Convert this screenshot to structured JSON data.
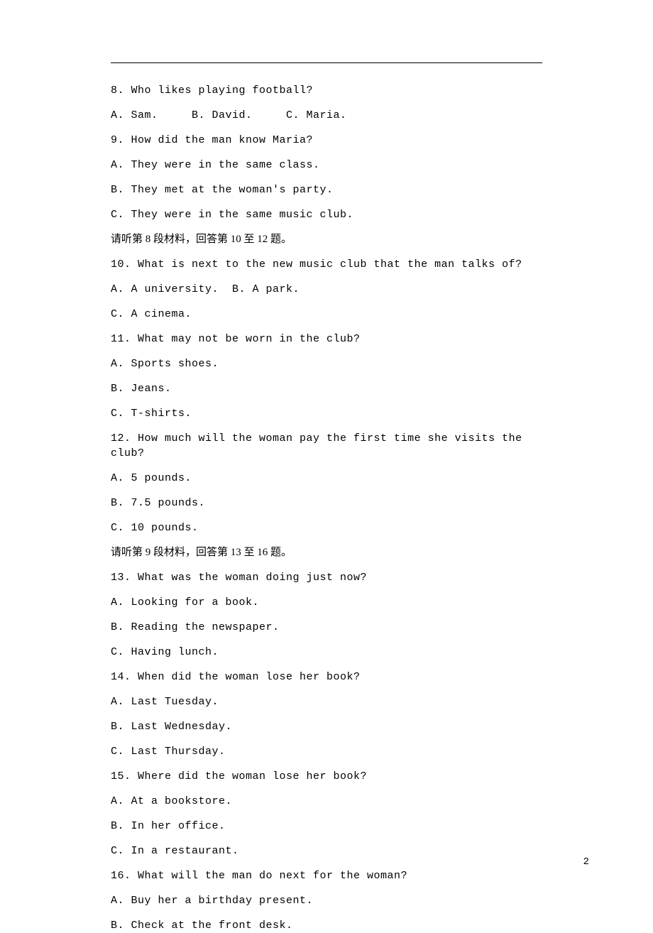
{
  "lines": [
    {
      "cls": "mono",
      "text": "8. Who likes playing football?"
    },
    {
      "cls": "mono",
      "text": "A. Sam.     B. David.     C. Maria."
    },
    {
      "cls": "mono",
      "text": "9. How did the man know Maria?"
    },
    {
      "cls": "mono",
      "text": "A. They were in the same class."
    },
    {
      "cls": "mono",
      "text": "B. They met at the woman's party."
    },
    {
      "cls": "mono",
      "text": "C. They were in the same music club."
    },
    {
      "cls": "",
      "text": "请听第 8 段材料，回答第 10 至 12 题。"
    },
    {
      "cls": "mono",
      "text": "10. What is next to the new music club that the man talks of?"
    },
    {
      "cls": "mono",
      "text": "A. A university.  B. A park."
    },
    {
      "cls": "mono",
      "text": "C. A cinema."
    },
    {
      "cls": "mono",
      "text": "11. What may not be worn in the club?"
    },
    {
      "cls": "mono",
      "text": "A. Sports shoes."
    },
    {
      "cls": "mono",
      "text": "B. Jeans."
    },
    {
      "cls": "mono",
      "text": "C. T-shirts."
    },
    {
      "cls": "mono",
      "text": "12. How much will the woman pay the first time she visits the club?"
    },
    {
      "cls": "mono",
      "text": "A. 5 pounds."
    },
    {
      "cls": "mono",
      "text": "B. 7.5 pounds."
    },
    {
      "cls": "mono",
      "text": "C. 10 pounds."
    },
    {
      "cls": "",
      "text": "请听第 9 段材料，回答第 13 至 16 题。"
    },
    {
      "cls": "mono",
      "text": "13. What was the woman doing just now?"
    },
    {
      "cls": "mono",
      "text": "A. Looking for a book."
    },
    {
      "cls": "mono",
      "text": "B. Reading the newspaper."
    },
    {
      "cls": "mono",
      "text": "C. Having lunch."
    },
    {
      "cls": "mono",
      "text": "14. When did the woman lose her book?"
    },
    {
      "cls": "mono",
      "text": "A. Last Tuesday."
    },
    {
      "cls": "mono",
      "text": "B. Last Wednesday."
    },
    {
      "cls": "mono",
      "text": "C. Last Thursday."
    },
    {
      "cls": "mono",
      "text": "15. Where did the woman lose her book?"
    },
    {
      "cls": "mono",
      "text": "A. At a bookstore."
    },
    {
      "cls": "mono",
      "text": "B. In her office."
    },
    {
      "cls": "mono",
      "text": "C. In a restaurant."
    },
    {
      "cls": "mono",
      "text": "16. What will the man do next for the woman?"
    },
    {
      "cls": "mono",
      "text": "A. Buy her a birthday present."
    },
    {
      "cls": "mono",
      "text": "B. Check at the front desk."
    }
  ],
  "page_number": "2"
}
